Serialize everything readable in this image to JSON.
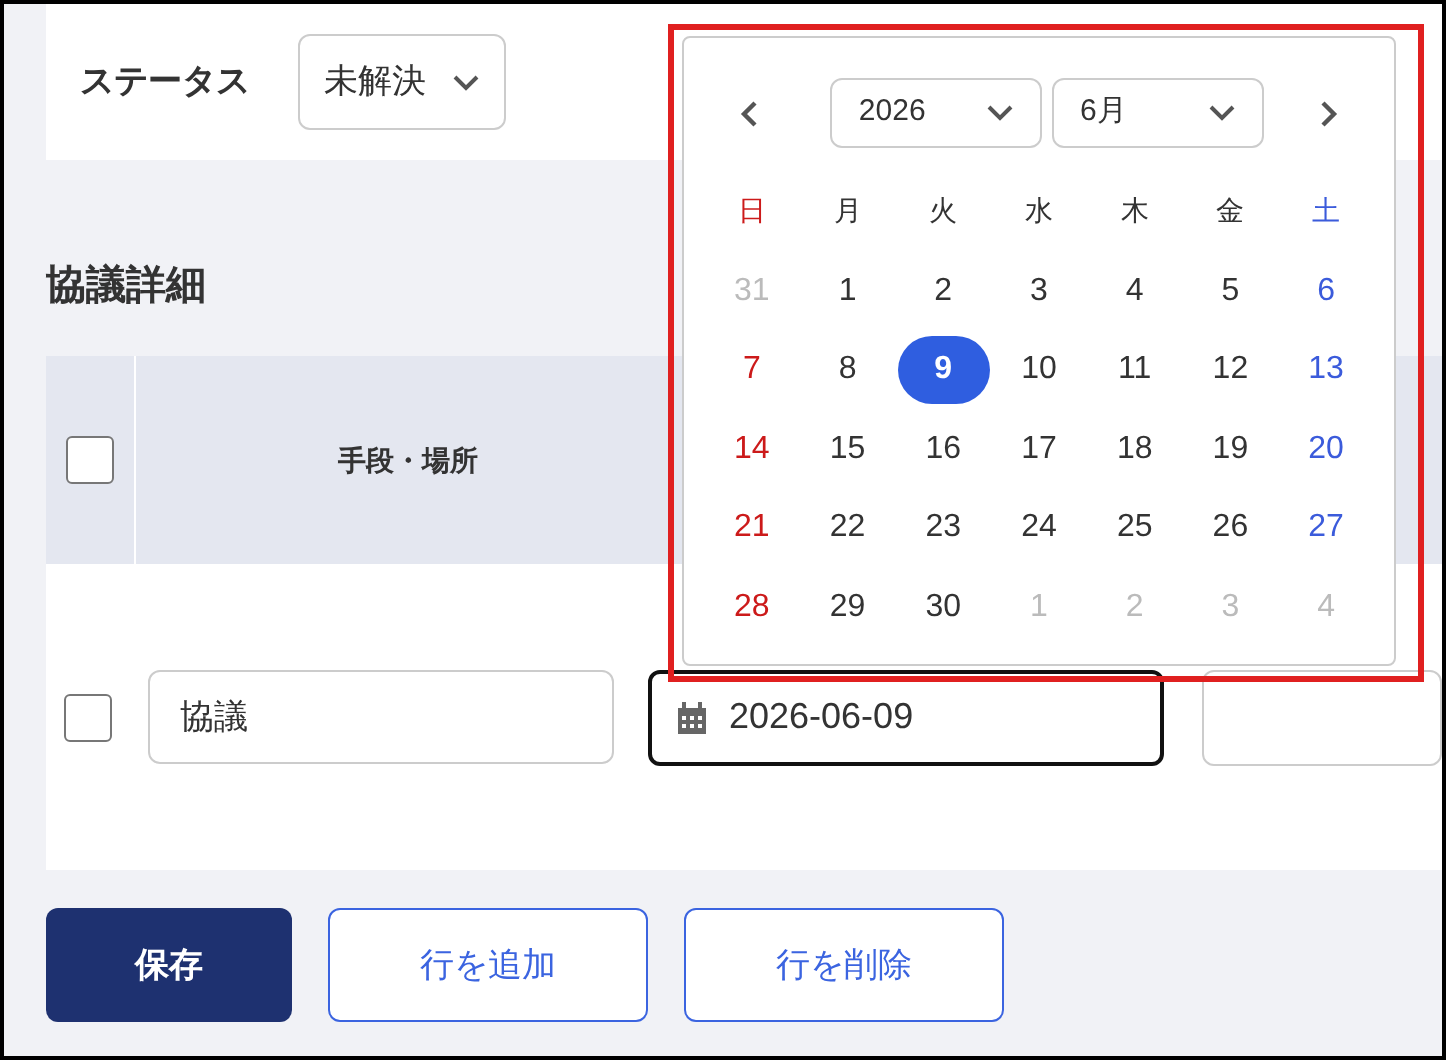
{
  "status": {
    "label": "ステータス",
    "value": "未解決"
  },
  "section_title": "協議詳細",
  "table": {
    "header_checked": false,
    "columns": [
      {
        "label": "手段・場所"
      }
    ],
    "rows": [
      {
        "checked": false,
        "method": "協議",
        "date": "2026-06-09"
      }
    ]
  },
  "datepicker": {
    "year": "2026",
    "month": "6月",
    "weekdays": [
      {
        "label": "日",
        "kind": "sunday"
      },
      {
        "label": "月",
        "kind": "weekday"
      },
      {
        "label": "火",
        "kind": "weekday"
      },
      {
        "label": "水",
        "kind": "weekday"
      },
      {
        "label": "木",
        "kind": "weekday"
      },
      {
        "label": "金",
        "kind": "weekday"
      },
      {
        "label": "土",
        "kind": "saturday"
      }
    ],
    "days": [
      {
        "label": "31",
        "kind": "outside",
        "selected": false
      },
      {
        "label": "1",
        "kind": "weekday",
        "selected": false
      },
      {
        "label": "2",
        "kind": "weekday",
        "selected": false
      },
      {
        "label": "3",
        "kind": "weekday",
        "selected": false
      },
      {
        "label": "4",
        "kind": "weekday",
        "selected": false
      },
      {
        "label": "5",
        "kind": "weekday",
        "selected": false
      },
      {
        "label": "6",
        "kind": "saturday",
        "selected": false
      },
      {
        "label": "7",
        "kind": "sunday",
        "selected": false
      },
      {
        "label": "8",
        "kind": "weekday",
        "selected": false
      },
      {
        "label": "9",
        "kind": "weekday",
        "selected": true
      },
      {
        "label": "10",
        "kind": "weekday",
        "selected": false
      },
      {
        "label": "11",
        "kind": "weekday",
        "selected": false
      },
      {
        "label": "12",
        "kind": "weekday",
        "selected": false
      },
      {
        "label": "13",
        "kind": "saturday",
        "selected": false
      },
      {
        "label": "14",
        "kind": "sunday",
        "selected": false
      },
      {
        "label": "15",
        "kind": "weekday",
        "selected": false
      },
      {
        "label": "16",
        "kind": "weekday",
        "selected": false
      },
      {
        "label": "17",
        "kind": "weekday",
        "selected": false
      },
      {
        "label": "18",
        "kind": "weekday",
        "selected": false
      },
      {
        "label": "19",
        "kind": "weekday",
        "selected": false
      },
      {
        "label": "20",
        "kind": "saturday",
        "selected": false
      },
      {
        "label": "21",
        "kind": "sunday",
        "selected": false
      },
      {
        "label": "22",
        "kind": "weekday",
        "selected": false
      },
      {
        "label": "23",
        "kind": "weekday",
        "selected": false
      },
      {
        "label": "24",
        "kind": "weekday",
        "selected": false
      },
      {
        "label": "25",
        "kind": "weekday",
        "selected": false
      },
      {
        "label": "26",
        "kind": "weekday",
        "selected": false
      },
      {
        "label": "27",
        "kind": "saturday",
        "selected": false
      },
      {
        "label": "28",
        "kind": "sunday",
        "selected": false
      },
      {
        "label": "29",
        "kind": "weekday",
        "selected": false
      },
      {
        "label": "30",
        "kind": "weekday",
        "selected": false
      },
      {
        "label": "1",
        "kind": "outside",
        "selected": false
      },
      {
        "label": "2",
        "kind": "outside",
        "selected": false
      },
      {
        "label": "3",
        "kind": "outside",
        "selected": false
      },
      {
        "label": "4",
        "kind": "outside",
        "selected": false
      }
    ]
  },
  "buttons": [
    {
      "label": "保存",
      "kind": "primary"
    },
    {
      "label": "行を追加",
      "kind": "outline"
    },
    {
      "label": "行を削除",
      "kind": "outline"
    }
  ]
}
